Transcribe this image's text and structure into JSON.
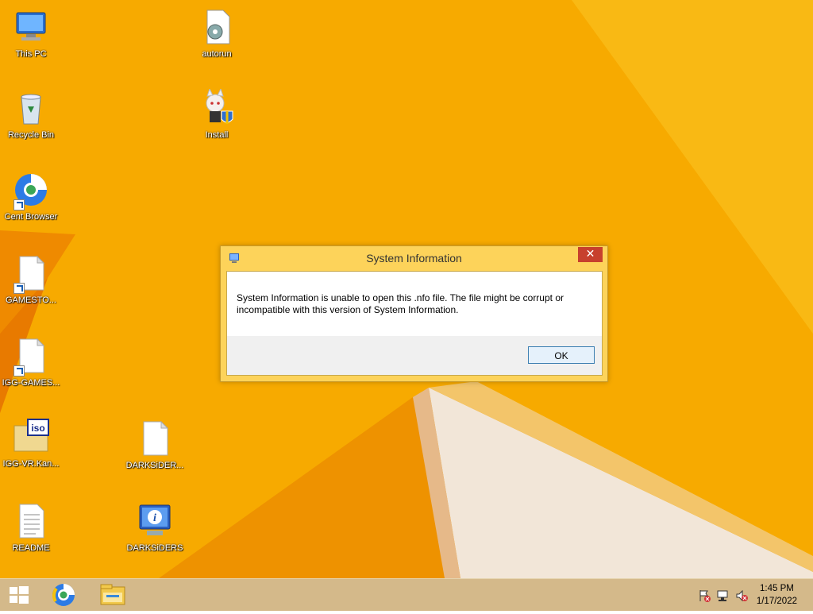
{
  "desktop": {
    "icons": [
      {
        "label": "This PC",
        "icon": "this-pc-icon"
      },
      {
        "label": "autorun",
        "icon": "settings-file-icon"
      },
      {
        "label": "Recycle Bin",
        "icon": "recycle-bin-icon"
      },
      {
        "label": "Install",
        "icon": "install-anime-icon"
      },
      {
        "label": "Cent Browser",
        "icon": "cent-browser-icon"
      },
      {
        "label": "GAMESTO...",
        "icon": "file-shortcut-icon"
      },
      {
        "label": "IGG-GAMES...",
        "icon": "file-shortcut-icon"
      },
      {
        "label": "IGG-VR.Kan...",
        "icon": "iso-file-icon"
      },
      {
        "label": "DARKSiDER...",
        "icon": "file-icon"
      },
      {
        "label": "README",
        "icon": "text-file-icon"
      },
      {
        "label": "DARKSiDERS",
        "icon": "system-info-icon"
      }
    ]
  },
  "dialog": {
    "title": "System Information",
    "close_glyph": "✕",
    "message_line1": "System Information is unable to open this .nfo file.  The file might be corrupt or",
    "message_line2": "incompatible with this version of System Information.",
    "ok_label": "OK"
  },
  "taskbar": {
    "clock_time": "1:45 PM",
    "clock_date": "1/17/2022"
  },
  "colors": {
    "wallpaper": "#f6a800",
    "taskbar": "#d4b98a",
    "close_button": "#c7402d",
    "ok_border": "#3c7fb1"
  }
}
